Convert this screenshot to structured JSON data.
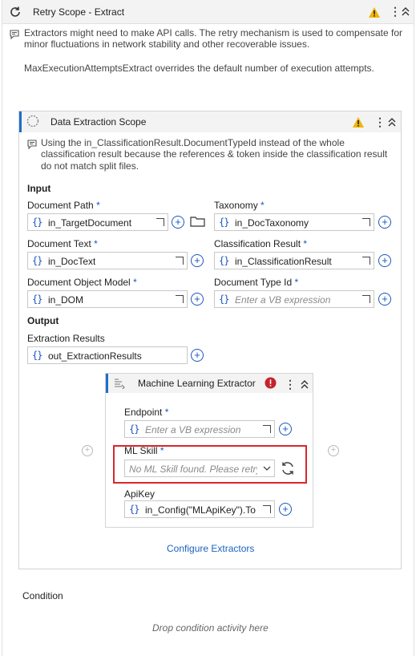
{
  "retry_scope": {
    "title": "Retry Scope - Extract",
    "annotation_lines": [
      "Extractors might need to make API calls. The retry mechanism is used to compensate for",
      "minor fluctuations in network stability and other recoverable issues."
    ],
    "annotation_extra": "MaxExecutionAttemptsExtract overrides the default number of execution attempts."
  },
  "data_extraction_scope": {
    "title": "Data Extraction Scope",
    "annotation_lines": [
      "Using the in_ClassificationResult.DocumentTypeId instead of the whole",
      "classification result because the references & token inside the classification result",
      "do not match split files."
    ],
    "input_section": "Input",
    "output_section": "Output",
    "fields": {
      "document_path": {
        "label": "Document Path",
        "value": "in_TargetDocument"
      },
      "taxonomy": {
        "label": "Taxonomy",
        "value": "in_DocTaxonomy"
      },
      "document_text": {
        "label": "Document Text",
        "value": "in_DocText"
      },
      "classification_result": {
        "label": "Classification Result",
        "value": "in_ClassificationResult"
      },
      "document_object_model": {
        "label": "Document Object Model",
        "value": "in_DOM"
      },
      "document_type_id": {
        "label": "Document Type Id",
        "placeholder": "Enter a VB expression"
      },
      "extraction_results": {
        "label": "Extraction Results",
        "value": "out_ExtractionResults"
      }
    },
    "required_mark": "*",
    "configure_link": "Configure Extractors"
  },
  "ml_extractor": {
    "title": "Machine Learning Extractor",
    "endpoint": {
      "label": "Endpoint",
      "placeholder": "Enter a VB expression"
    },
    "ml_skill": {
      "label": "ML Skill",
      "placeholder": "No ML Skill found. Please retry."
    },
    "api_key": {
      "label": "ApiKey",
      "value": "in_Config(\"MLApiKey\").To"
    }
  },
  "condition": {
    "label": "Condition",
    "drop_hint": "Drop condition activity here"
  },
  "icons": {
    "curly": "{}",
    "plus": "+",
    "warning": "warning-icon",
    "error": "error-icon"
  },
  "colors": {
    "accent_blue": "#1a56c2",
    "warning": "#f0b400",
    "error_red": "#d9262c"
  }
}
